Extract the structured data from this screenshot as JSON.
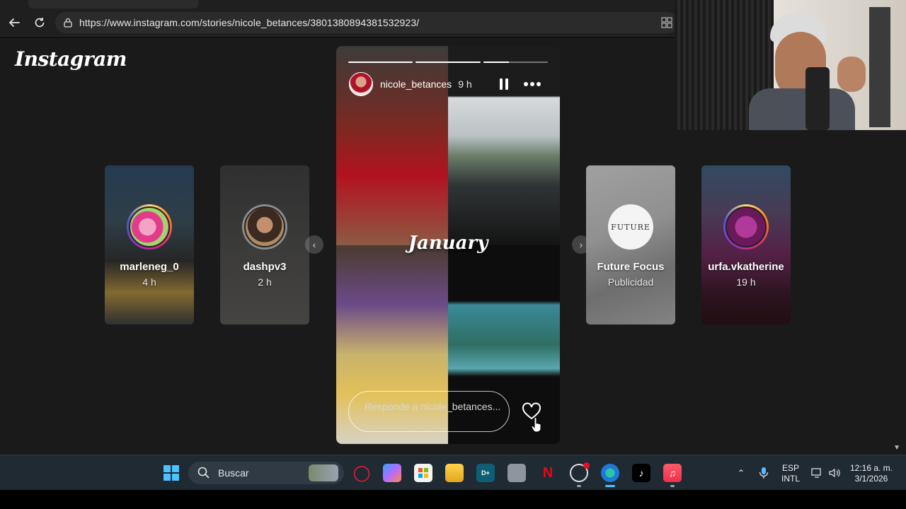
{
  "browser": {
    "url": "https://www.instagram.com/stories/nicole_betances/3801380894381532923/"
  },
  "page": {
    "logo": "Instagram",
    "previews": [
      {
        "username": "marleneg_0",
        "time": "4 h"
      },
      {
        "username": "dashpv3",
        "time": "2 h"
      },
      {
        "username": "Future Focus",
        "time": "Publicidad",
        "avatar_text": "FUTURE"
      },
      {
        "username": "urfa.vkatherine",
        "time": "19 h"
      }
    ]
  },
  "story": {
    "username": "nicole_betances",
    "time": "9 h",
    "overlay_title": "January",
    "reply_placeholder": "Responde a nicole_betances...",
    "progress": [
      1,
      1,
      0.4
    ]
  },
  "taskbar": {
    "search_label": "Buscar",
    "lang_top": "ESP",
    "lang_bottom": "INTL",
    "time": "12:16 a. m.",
    "date": "3/1/2026"
  }
}
